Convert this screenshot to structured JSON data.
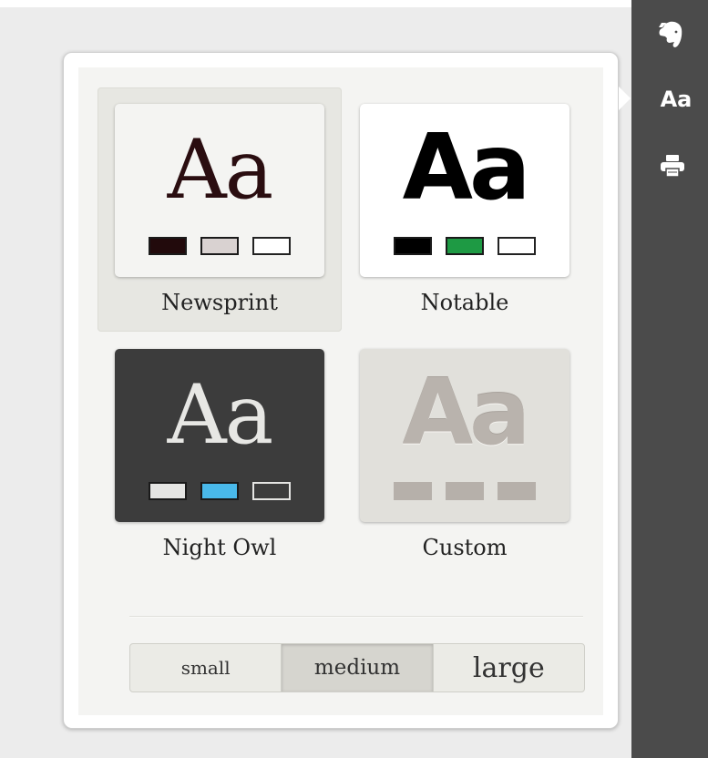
{
  "toolbar": {
    "icons": [
      "evernote-elephant-icon",
      "font-icon",
      "print-icon"
    ],
    "font_icon_label": "Aa"
  },
  "themes": [
    {
      "name": "Newsprint",
      "sample": "Aa",
      "selected": true,
      "swatches": [
        "#220a0c",
        "#d9d2d1",
        "#ffffff"
      ]
    },
    {
      "name": "Notable",
      "sample": "Aa",
      "selected": false,
      "swatches": [
        "#000000",
        "#1e9a44",
        "#ffffff"
      ]
    },
    {
      "name": "Night Owl",
      "sample": "Aa",
      "selected": false,
      "swatches": [
        "#e5e5e3",
        "#49b9ea",
        "#3c3c3c"
      ]
    },
    {
      "name": "Custom",
      "sample": "Aa",
      "selected": false,
      "swatches": [
        "#b6b0aa",
        "#b6b0aa",
        "#b6b0aa"
      ]
    }
  ],
  "text_size": {
    "options": [
      "small",
      "medium",
      "large"
    ],
    "selected": "medium"
  }
}
